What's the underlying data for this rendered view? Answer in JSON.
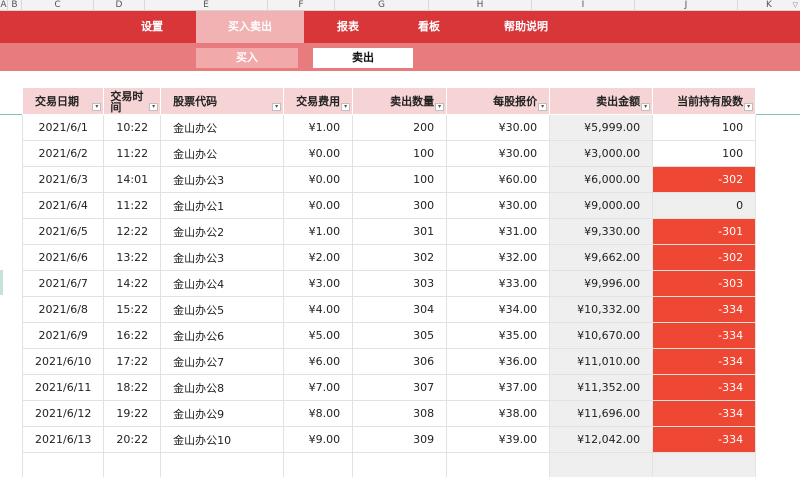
{
  "columns": [
    "A",
    "B",
    "C",
    "D",
    "E",
    "F",
    "G",
    "H",
    "I",
    "J",
    "K"
  ],
  "nav": {
    "tabs": [
      {
        "label": "设置"
      },
      {
        "label": "买入卖出"
      },
      {
        "label": "报表"
      },
      {
        "label": "看板"
      },
      {
        "label": "帮助说明"
      }
    ],
    "active": "买入卖出"
  },
  "subnav": {
    "buy_label": "买入",
    "sell_label": "卖出",
    "active": "卖出"
  },
  "table": {
    "headers": [
      "交易日期",
      "交易时间",
      "股票代码",
      "交易费用",
      "卖出数量",
      "每股报价",
      "卖出金额",
      "当前持有股数"
    ],
    "rows": [
      [
        "2021/6/1",
        "10:22",
        "金山办公",
        "¥1.00",
        "200",
        "¥30.00",
        "¥5,999.00",
        "100"
      ],
      [
        "2021/6/2",
        "11:22",
        "金山办公",
        "¥0.00",
        "100",
        "¥30.00",
        "¥3,000.00",
        "100"
      ],
      [
        "2021/6/3",
        "14:01",
        "金山办公3",
        "¥0.00",
        "100",
        "¥60.00",
        "¥6,000.00",
        "-302"
      ],
      [
        "2021/6/4",
        "11:22",
        "金山办公1",
        "¥0.00",
        "300",
        "¥30.00",
        "¥9,000.00",
        "0"
      ],
      [
        "2021/6/5",
        "12:22",
        "金山办公2",
        "¥1.00",
        "301",
        "¥31.00",
        "¥9,330.00",
        "-301"
      ],
      [
        "2021/6/6",
        "13:22",
        "金山办公3",
        "¥2.00",
        "302",
        "¥32.00",
        "¥9,662.00",
        "-302"
      ],
      [
        "2021/6/7",
        "14:22",
        "金山办公4",
        "¥3.00",
        "303",
        "¥33.00",
        "¥9,996.00",
        "-303"
      ],
      [
        "2021/6/8",
        "15:22",
        "金山办公5",
        "¥4.00",
        "304",
        "¥34.00",
        "¥10,332.00",
        "-334"
      ],
      [
        "2021/6/9",
        "16:22",
        "金山办公6",
        "¥5.00",
        "305",
        "¥35.00",
        "¥10,670.00",
        "-334"
      ],
      [
        "2021/6/10",
        "17:22",
        "金山办公7",
        "¥6.00",
        "306",
        "¥36.00",
        "¥11,010.00",
        "-334"
      ],
      [
        "2021/6/11",
        "18:22",
        "金山办公8",
        "¥7.00",
        "307",
        "¥37.00",
        "¥11,352.00",
        "-334"
      ],
      [
        "2021/6/12",
        "19:22",
        "金山办公9",
        "¥8.00",
        "308",
        "¥38.00",
        "¥11,696.00",
        "-334"
      ],
      [
        "2021/6/13",
        "20:22",
        "金山办公10",
        "¥9.00",
        "309",
        "¥39.00",
        "¥12,042.00",
        "-334"
      ]
    ]
  },
  "colors": {
    "nav_bg": "#d9363a",
    "nav_active": "#f0b2b3",
    "subnav_bg": "#e77b7d",
    "header_bg": "#f6d3d4",
    "negative_bg": "#ee4733",
    "amount_bg": "#efefef"
  }
}
